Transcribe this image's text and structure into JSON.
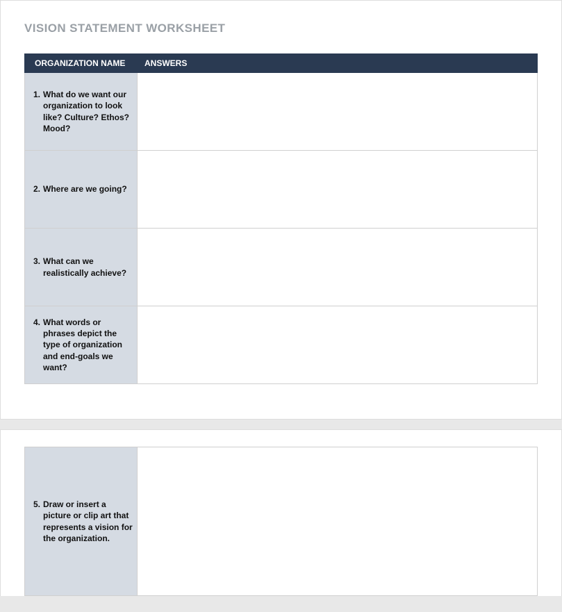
{
  "title": "VISION STATEMENT WORKSHEET",
  "headers": {
    "col1": "ORGANIZATION NAME",
    "col2": "ANSWERS"
  },
  "questions": [
    {
      "num": "1.",
      "text": "What do we want our organization to look like? Culture? Ethos? Mood?",
      "answer": ""
    },
    {
      "num": "2.",
      "text": "Where are we going?",
      "answer": ""
    },
    {
      "num": "3.",
      "text": "What can we realistically achieve?",
      "answer": ""
    },
    {
      "num": "4.",
      "text": "What words or phrases depict the type of organization and end-goals we want?",
      "answer": ""
    },
    {
      "num": "5.",
      "text": "Draw or insert a picture or clip art that represents a vision for the organization.",
      "answer": ""
    }
  ]
}
